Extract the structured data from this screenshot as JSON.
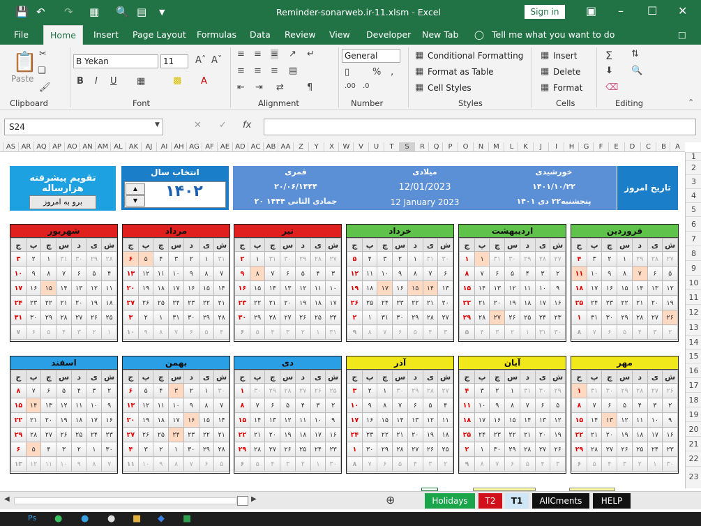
{
  "window": {
    "title": "Reminder-sonarweb.ir-11.xlsm  -  Excel",
    "sign_in": "Sign in"
  },
  "menu": [
    "File",
    "Home",
    "Insert",
    "Page Layout",
    "Formulas",
    "Data",
    "Review",
    "View",
    "Developer",
    "New Tab"
  ],
  "tell_me": "Tell me what you want to do",
  "ribbon": {
    "paste": "Paste",
    "font_name": "B Yekan",
    "font_size": "11",
    "number_format": "General",
    "conditional_formatting": "Conditional Formatting",
    "format_as_table": "Format as Table",
    "cell_styles": "Cell Styles",
    "insert": "Insert",
    "delete": "Delete",
    "format": "Format",
    "groups": {
      "clipboard": "Clipboard",
      "font": "Font",
      "alignment": "Alignment",
      "number": "Number",
      "styles": "Styles",
      "cells": "Cells",
      "editing": "Editing"
    }
  },
  "formula_bar": {
    "name_box": "S24",
    "fx": "fx"
  },
  "columns": [
    "A",
    "B",
    "C",
    "D",
    "E",
    "F",
    "G",
    "H",
    "I",
    "J",
    "K",
    "L",
    "M",
    "N",
    "O",
    "P",
    "Q",
    "R",
    "S",
    "T",
    "U",
    "V",
    "W",
    "X",
    "Y",
    "Z",
    "AA",
    "AB",
    "AC",
    "AD",
    "AE",
    "AF",
    "AG",
    "AH",
    "AI",
    "AJ",
    "AK",
    "AL",
    "AM",
    "AN",
    "AO",
    "AP",
    "AQ",
    "AR",
    "AS",
    "AT",
    "AU",
    "AV",
    "AW"
  ],
  "rows": [
    "1",
    "2",
    "3",
    "4",
    "5",
    "6",
    "7",
    "8",
    "9",
    "10",
    "11",
    "12",
    "13",
    "14",
    "15",
    "16",
    "17",
    "18",
    "19",
    "20",
    "21",
    "22",
    "23"
  ],
  "header": {
    "app_title": "تقویم پیشرفته هزارساله",
    "go_today": "برو به امروز",
    "select_year": "انتخاب سال",
    "year": "۱۴۰۲",
    "qamari_label": "قمری",
    "qamari_date": "۲۰/۰۶/۱۴۴۴",
    "qamari_text": "۲۰ جمادی الثانی ۱۴۴۴",
    "miladi_label": "میلادی",
    "miladi_date": "12/01/2023",
    "miladi_text": "12 January 2023",
    "shamsi_label": "خورشیدی",
    "shamsi_date": "۱۴۰۱/۱۰/۲۲",
    "shamsi_text": "پنجشنبه۲۲ دی ۱۴۰۱",
    "today_label": "تاریخ امروز"
  },
  "weekdays": [
    "ش",
    "ی",
    "د",
    "س",
    "چ",
    "پ",
    "ج"
  ],
  "months": [
    {
      "name": "فروردین",
      "color": "#5fc24a",
      "hl": [
        9,
        13,
        28
      ],
      "weeks": [
        [
          "۲۷",
          "۲۸",
          "۲۹",
          "۱",
          "۲",
          "۳",
          "۴"
        ],
        [
          "۵",
          "۶",
          "۷",
          "۸",
          "۹",
          "۱۰",
          "۱۱"
        ],
        [
          "۱۲",
          "۱۳",
          "۱۴",
          "۱۵",
          "۱۶",
          "۱۷",
          "۱۸"
        ],
        [
          "۱۹",
          "۲۰",
          "۲۱",
          "۲۲",
          "۲۳",
          "۲۴",
          "۲۵"
        ],
        [
          "۲۶",
          "۲۷",
          "۲۸",
          "۲۹",
          "۳۰",
          "۳۱",
          "۱"
        ],
        [
          "۲",
          "۳",
          "۴",
          "۵",
          "۶",
          "۷",
          "۸"
        ]
      ]
    },
    {
      "name": "اردیبهشت",
      "color": "#5fc24a",
      "hl": [
        5,
        32
      ],
      "weeks": [
        [
          "۲۷",
          "۲۸",
          "۲۹",
          "۳۰",
          "۳۱",
          "۱",
          "۱"
        ],
        [
          "۲",
          "۳",
          "۴",
          "۵",
          "۶",
          "۷",
          "۸"
        ],
        [
          "۹",
          "۱۰",
          "۱۱",
          "۱۲",
          "۱۳",
          "۱۴",
          "۱۵"
        ],
        [
          "۱۶",
          "۱۷",
          "۱۸",
          "۱۹",
          "۲۰",
          "۲۱",
          "۲۲"
        ],
        [
          "۲۳",
          "۲۴",
          "۲۵",
          "۲۶",
          "۲۷",
          "۲۸",
          "۲۹"
        ],
        [
          "۳۰",
          "۳۱",
          "۱",
          "۲",
          "۳",
          "۴",
          "۵"
        ]
      ]
    },
    {
      "name": "خرداد",
      "color": "#5fc24a",
      "hl": [
        15,
        16,
        18
      ],
      "weeks": [
        [
          "۳۰",
          "۳۱",
          "۱",
          "۲",
          "۳",
          "۴",
          "۵"
        ],
        [
          "۶",
          "۷",
          "۸",
          "۹",
          "۱۰",
          "۱۱",
          "۱۲"
        ],
        [
          "۱۳",
          "۱۴",
          "۱۵",
          "۱۶",
          "۱۷",
          "۱۸",
          "۱۹"
        ],
        [
          "۲۰",
          "۲۱",
          "۲۲",
          "۲۳",
          "۲۴",
          "۲۵",
          "۲۶"
        ],
        [
          "۲۷",
          "۲۸",
          "۲۹",
          "۳۰",
          "۳۱",
          "۱",
          "۲"
        ],
        [
          "۳",
          "۴",
          "۵",
          "۶",
          "۷",
          "۸",
          "۹"
        ]
      ]
    },
    {
      "name": "تیر",
      "color": "#e0201e",
      "hl": [
        12
      ],
      "weeks": [
        [
          "۲۷",
          "۲۸",
          "۲۹",
          "۳۰",
          "۳۱",
          "۱",
          "۲"
        ],
        [
          "۳",
          "۴",
          "۵",
          "۶",
          "۷",
          "۸",
          "۹"
        ],
        [
          "۱۰",
          "۱۱",
          "۱۲",
          "۱۳",
          "۱۴",
          "۱۵",
          "۱۶"
        ],
        [
          "۱۷",
          "۱۸",
          "۱۹",
          "۲۰",
          "۲۱",
          "۲۲",
          "۲۳"
        ],
        [
          "۲۴",
          "۲۵",
          "۲۶",
          "۲۷",
          "۲۸",
          "۲۹",
          "۳۰"
        ],
        [
          "۳۱",
          "۱",
          "۲",
          "۳",
          "۴",
          "۵",
          "۶"
        ]
      ]
    },
    {
      "name": "مرداد",
      "color": "#e0201e",
      "hl": [
        5,
        6
      ],
      "weeks": [
        [
          "۳۱",
          "۱",
          "۲",
          "۳",
          "۴",
          "۵",
          "۶"
        ],
        [
          "۷",
          "۸",
          "۹",
          "۱۰",
          "۱۱",
          "۱۲",
          "۱۳"
        ],
        [
          "۱۴",
          "۱۵",
          "۱۶",
          "۱۷",
          "۱۸",
          "۱۹",
          "۲۰"
        ],
        [
          "۲۱",
          "۲۲",
          "۲۳",
          "۲۴",
          "۲۵",
          "۲۶",
          "۲۷"
        ],
        [
          "۲۸",
          "۲۹",
          "۳۰",
          "۳۱",
          "۱",
          "۲",
          "۳"
        ],
        [
          "۴",
          "۵",
          "۶",
          "۷",
          "۸",
          "۹",
          "۱۰"
        ]
      ]
    },
    {
      "name": "شهریور",
      "color": "#e0201e",
      "hl": [
        18
      ],
      "weeks": [
        [
          "۲۸",
          "۲۹",
          "۳۰",
          "۳۱",
          "۱",
          "۲",
          "۳"
        ],
        [
          "۴",
          "۵",
          "۶",
          "۷",
          "۸",
          "۹",
          "۱۰"
        ],
        [
          "۱۱",
          "۱۲",
          "۱۳",
          "۱۴",
          "۱۵",
          "۱۶",
          "۱۷"
        ],
        [
          "۱۸",
          "۱۹",
          "۲۰",
          "۲۱",
          "۲۲",
          "۲۳",
          "۲۴"
        ],
        [
          "۲۵",
          "۲۶",
          "۲۷",
          "۲۸",
          "۲۹",
          "۳۰",
          "۳۱"
        ],
        [
          "۱",
          "۲",
          "۳",
          "۴",
          "۵",
          "۶",
          "۷"
        ]
      ]
    },
    {
      "name": "مهر",
      "color": "#f0e81a",
      "hl": [
        6,
        18
      ],
      "weeks": [
        [
          "۲۶",
          "۲۷",
          "۲۸",
          "۲۹",
          "۳۰",
          "۳۱",
          "۱"
        ],
        [
          "۲",
          "۳",
          "۴",
          "۵",
          "۶",
          "۷",
          "۸"
        ],
        [
          "۹",
          "۱۰",
          "۱۱",
          "۱۲",
          "۱۳",
          "۱۴",
          "۱۵"
        ],
        [
          "۱۶",
          "۱۷",
          "۱۸",
          "۱۹",
          "۲۰",
          "۲۱",
          "۲۲"
        ],
        [
          "۲۳",
          "۲۴",
          "۲۵",
          "۲۶",
          "۲۷",
          "۲۸",
          "۲۹"
        ],
        [
          "۳۰",
          "۱",
          "۲",
          "۳",
          "۴",
          "۵",
          "۶"
        ]
      ]
    },
    {
      "name": "آبان",
      "color": "#f0e81a",
      "hl": [],
      "weeks": [
        [
          "۲۹",
          "۳۰",
          "۳۱",
          "۱",
          "۲",
          "۳",
          "۴"
        ],
        [
          "۵",
          "۶",
          "۷",
          "۸",
          "۹",
          "۱۰",
          "۱۱"
        ],
        [
          "۱۲",
          "۱۳",
          "۱۴",
          "۱۵",
          "۱۶",
          "۱۷",
          "۱۸"
        ],
        [
          "۱۹",
          "۲۰",
          "۲۱",
          "۲۲",
          "۲۳",
          "۲۴",
          "۲۵"
        ],
        [
          "۲۶",
          "۲۷",
          "۲۸",
          "۲۹",
          "۳۰",
          "۱",
          "۲"
        ],
        [
          "۳",
          "۴",
          "۵",
          "۶",
          "۷",
          "۸",
          "۹"
        ]
      ]
    },
    {
      "name": "آذر",
      "color": "#f0e81a",
      "hl": [],
      "weeks": [
        [
          "۲۷",
          "۲۸",
          "۲۹",
          "۳۰",
          "۱",
          "۲",
          "۳"
        ],
        [
          "۴",
          "۵",
          "۶",
          "۷",
          "۸",
          "۹",
          "۱۰"
        ],
        [
          "۱۱",
          "۱۲",
          "۱۳",
          "۱۴",
          "۱۵",
          "۱۶",
          "۱۷"
        ],
        [
          "۱۸",
          "۱۹",
          "۲۰",
          "۲۱",
          "۲۲",
          "۲۳",
          "۲۴"
        ],
        [
          "۲۵",
          "۲۶",
          "۲۷",
          "۲۸",
          "۲۹",
          "۳۰",
          "۱"
        ],
        [
          "۲",
          "۳",
          "۴",
          "۵",
          "۶",
          "۷",
          "۸"
        ]
      ]
    },
    {
      "name": "دی",
      "color": "#2a9fe6",
      "hl": [],
      "weeks": [
        [
          "۲۵",
          "۲۶",
          "۲۷",
          "۲۸",
          "۲۹",
          "۳۰",
          "۱"
        ],
        [
          "۲",
          "۳",
          "۴",
          "۵",
          "۶",
          "۷",
          "۸"
        ],
        [
          "۹",
          "۱۰",
          "۱۱",
          "۱۲",
          "۱۳",
          "۱۴",
          "۱۵"
        ],
        [
          "۱۶",
          "۱۷",
          "۱۸",
          "۱۹",
          "۲۰",
          "۲۱",
          "۲۲"
        ],
        [
          "۲۳",
          "۲۴",
          "۲۵",
          "۲۶",
          "۲۷",
          "۲۸",
          "۲۹"
        ],
        [
          "۳۰",
          "۱",
          "۲",
          "۳",
          "۴",
          "۵",
          "۶"
        ]
      ]
    },
    {
      "name": "بهمن",
      "color": "#2a9fe6",
      "hl": [
        3,
        16,
        24
      ],
      "weeks": [
        [
          "۳۰",
          "۱",
          "۲",
          "۳",
          "۴",
          "۵",
          "۶"
        ],
        [
          "۷",
          "۸",
          "۹",
          "۱۰",
          "۱۱",
          "۱۲",
          "۱۳"
        ],
        [
          "۱۴",
          "۱۵",
          "۱۶",
          "۱۷",
          "۱۸",
          "۱۹",
          "۲۰"
        ],
        [
          "۲۱",
          "۲۲",
          "۲۳",
          "۲۴",
          "۲۵",
          "۲۶",
          "۲۷"
        ],
        [
          "۲۸",
          "۲۹",
          "۳۰",
          "۱",
          "۲",
          "۳",
          "۴"
        ],
        [
          "۵",
          "۶",
          "۷",
          "۸",
          "۹",
          "۱۰",
          "۱۱"
        ]
      ]
    },
    {
      "name": "اسفند",
      "color": "#2a9fe6",
      "hl": [
        12,
        33
      ],
      "weeks": [
        [
          "۲",
          "۳",
          "۴",
          "۵",
          "۶",
          "۷",
          "۸"
        ],
        [
          "۹",
          "۱۰",
          "۱۱",
          "۱۲",
          "۱۳",
          "۱۴",
          "۱۵"
        ],
        [
          "۱۶",
          "۱۷",
          "۱۸",
          "۱۹",
          "۲۰",
          "۲۱",
          "۲۲"
        ],
        [
          "۲۳",
          "۲۴",
          "۲۵",
          "۲۶",
          "۲۷",
          "۲۸",
          "۲۹"
        ],
        [
          "۳۰",
          "۱",
          "۲",
          "۳",
          "۴",
          "۵",
          "۶"
        ],
        [
          "۷",
          "۸",
          "۹",
          "۱۰",
          "۱۱",
          "۱۲",
          "۱۳"
        ]
      ]
    }
  ],
  "sheet_tabs": [
    {
      "label": "Holidays",
      "color": "#1aa54a"
    },
    {
      "label": "T2",
      "color": "#d0101a"
    },
    {
      "label": "T1",
      "color": "#cfe6f7"
    },
    {
      "label": "AllCments",
      "color": "#111111"
    },
    {
      "label": "HELP",
      "color": "#111111"
    }
  ]
}
